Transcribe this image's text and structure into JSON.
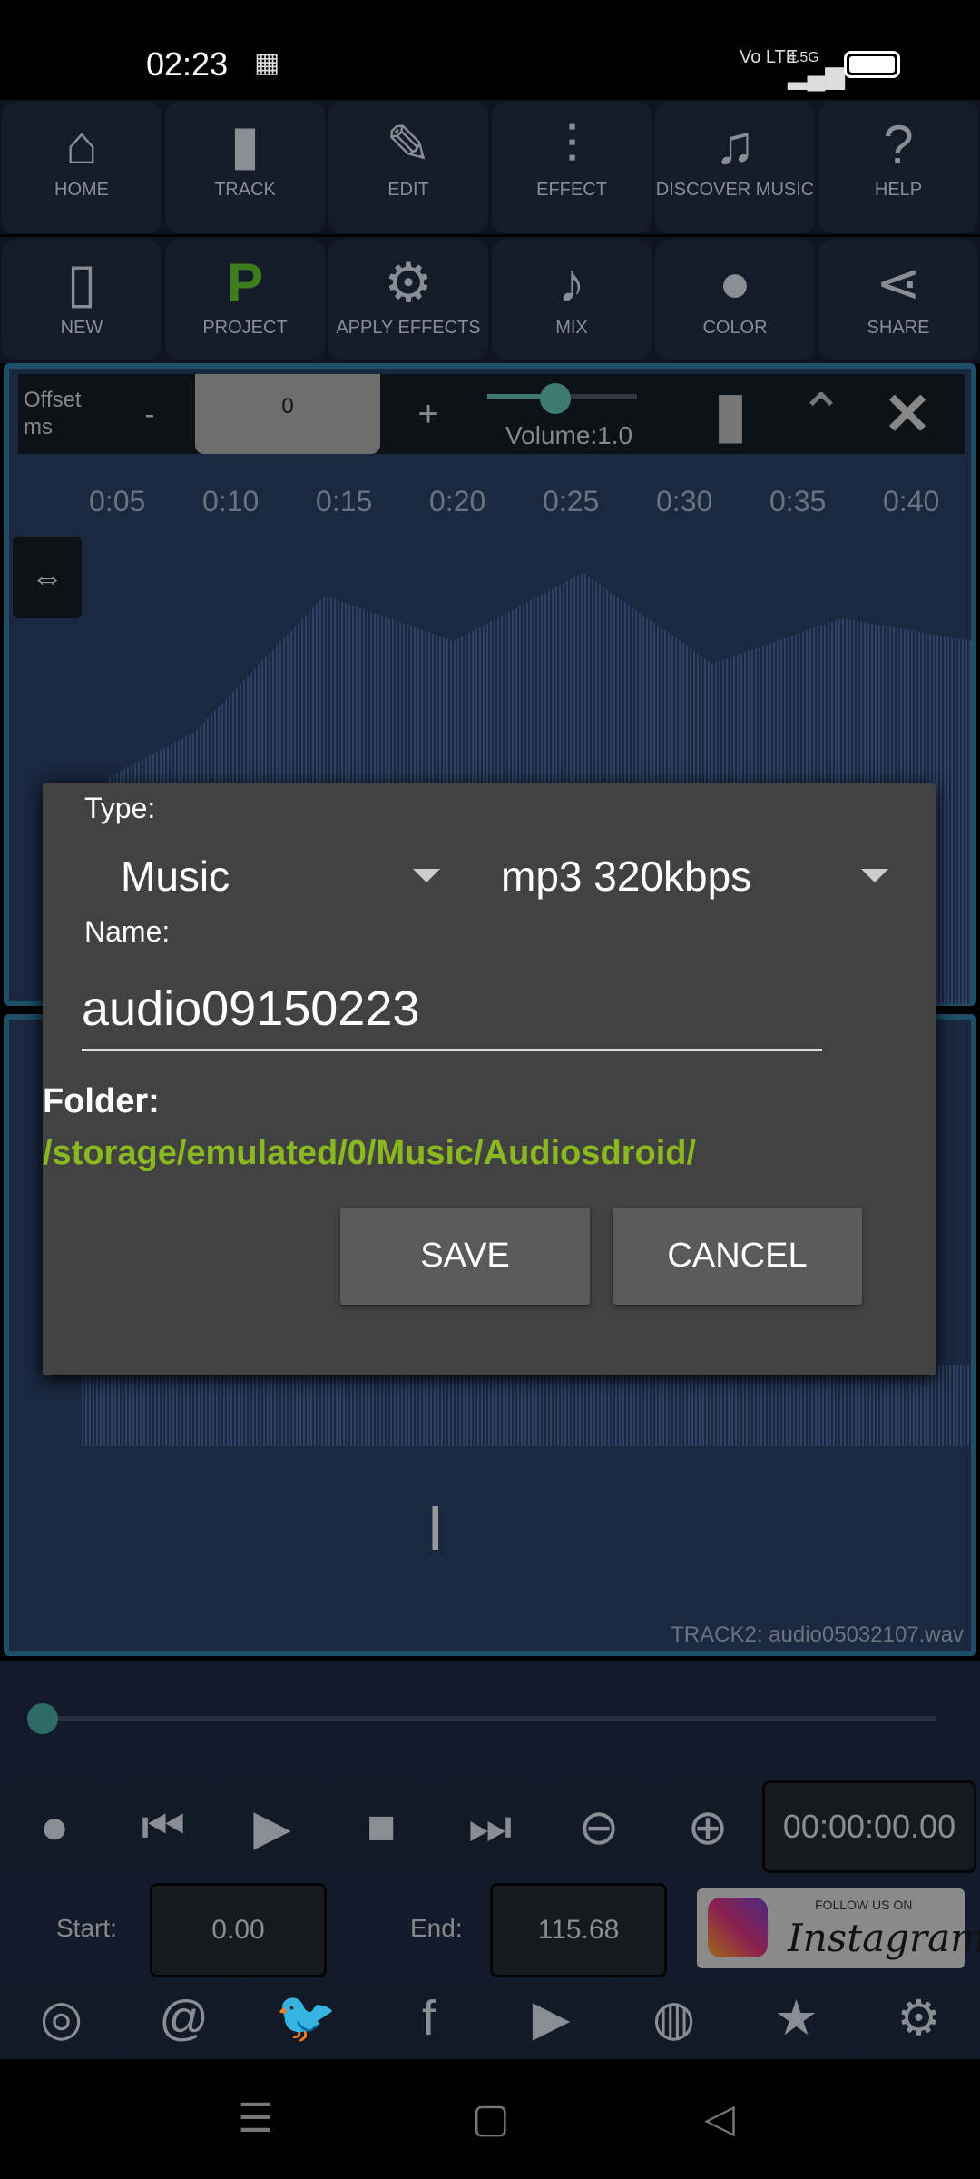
{
  "status": {
    "time": "02:23",
    "network": "4.5G",
    "volte": "Vo LTE"
  },
  "toolbar1": [
    {
      "icon": "home-icon",
      "glyph": "⌂",
      "label": "HOME"
    },
    {
      "icon": "waveform-icon",
      "glyph": "▮",
      "label": "TRACK"
    },
    {
      "icon": "edit-icon",
      "glyph": "✎",
      "label": "EDIT"
    },
    {
      "icon": "sliders-icon",
      "glyph": "⫶",
      "label": "EFFECT"
    },
    {
      "icon": "music-disc-icon",
      "glyph": "♫",
      "label": "DISCOVER MUSIC"
    },
    {
      "icon": "help-icon",
      "glyph": "?",
      "label": "HELP"
    }
  ],
  "toolbar2": [
    {
      "icon": "new-file-icon",
      "glyph": "▯",
      "label": "NEW"
    },
    {
      "icon": "project-icon",
      "glyph": "P",
      "label": "PROJECT"
    },
    {
      "icon": "gear-check-icon",
      "glyph": "⚙",
      "label": "APPLY EFFECTS"
    },
    {
      "icon": "mix-icon",
      "glyph": "♪",
      "label": "MIX"
    },
    {
      "icon": "color-wheel-icon",
      "glyph": "●",
      "label": "COLOR"
    },
    {
      "icon": "share-icon",
      "glyph": "⋖",
      "label": "SHARE"
    }
  ],
  "track1": {
    "offset_label": "Offset ms",
    "minus": "-",
    "offset_value": "0",
    "plus": "+",
    "volume": "Volume:1.0",
    "volume_level": 0.45,
    "ticks": [
      "0:05",
      "0:10",
      "0:15",
      "0:20",
      "0:25",
      "0:30",
      "0:35",
      "0:40"
    ]
  },
  "track2": {
    "label": "TRACK2: audio05032107.wav"
  },
  "dialog": {
    "type_label": "Type:",
    "type_value": "Music",
    "format_value": "mp3 320kbps",
    "name_label": "Name:",
    "name_value": "audio09150223",
    "folder_label": "Folder:",
    "folder_path": "/storage/emulated/0/Music/Audiosdroid/",
    "save": "SAVE",
    "cancel": "CANCEL",
    "folder_color": "#8ab81f"
  },
  "transport": {
    "time": "00:00:00.00"
  },
  "range": {
    "start_label": "Start:",
    "start_value": "0.00",
    "end_label": "End:",
    "end_value": "115.68",
    "instagram_top": "FOLLOW US ON",
    "instagram_text": "Instagram"
  },
  "social": [
    {
      "icon": "instagram-icon",
      "glyph": "◎"
    },
    {
      "icon": "threads-icon",
      "glyph": "@"
    },
    {
      "icon": "twitter-icon",
      "glyph": "🐦"
    },
    {
      "icon": "facebook-icon",
      "glyph": "f"
    },
    {
      "icon": "youtube-icon",
      "glyph": "▶"
    },
    {
      "icon": "globe-icon",
      "glyph": "◍"
    },
    {
      "icon": "star-icon",
      "glyph": "★"
    },
    {
      "icon": "settings-icon",
      "glyph": "⚙"
    }
  ]
}
